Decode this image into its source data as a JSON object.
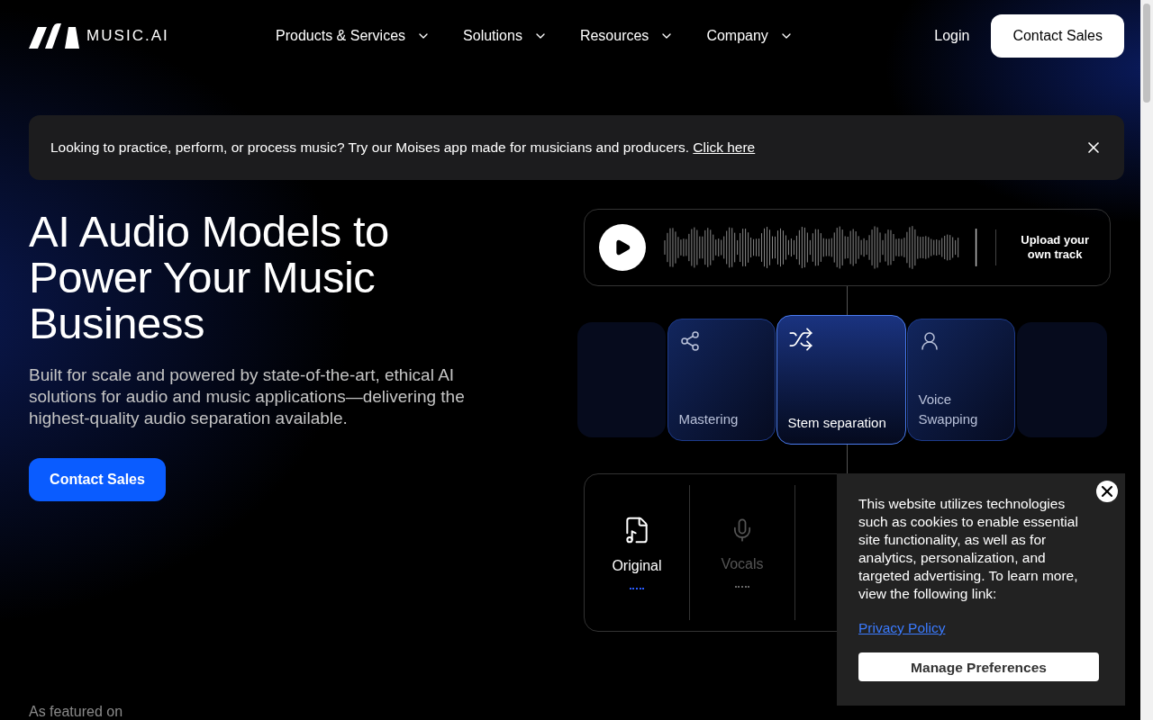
{
  "header": {
    "logo_text": "MUSIC.AI",
    "nav": [
      {
        "label": "Products & Services"
      },
      {
        "label": "Solutions"
      },
      {
        "label": "Resources"
      },
      {
        "label": "Company"
      }
    ],
    "login": "Login",
    "cta": "Contact Sales"
  },
  "banner": {
    "text": "Looking to practice, perform, or process music? Try our Moises app made for musicians and producers.",
    "link": "Click here"
  },
  "hero": {
    "title": "AI Audio Models to Power Your Music Business",
    "subtitle": "Built for scale and powered by state-of-the-art, ethical AI solutions for audio and music applications—delivering the highest-quality audio separation available.",
    "cta": "Contact Sales",
    "featured": "As featured on"
  },
  "player": {
    "upload": "Upload your own track"
  },
  "models": [
    {
      "label": "Mastering",
      "selected": false
    },
    {
      "label": "Stem separation",
      "selected": true
    },
    {
      "label": "Voice Swapping",
      "selected": false
    }
  ],
  "stems": [
    {
      "label": "Original",
      "selected": true
    },
    {
      "label": "Vocals",
      "selected": false
    }
  ],
  "cookie": {
    "text": "This website utilizes technologies such as cookies to enable essential site functionality, as well as for analytics, personalization, and targeted advertising. To learn more, view the following link:",
    "link": "Privacy Policy",
    "button": "Manage Preferences"
  }
}
